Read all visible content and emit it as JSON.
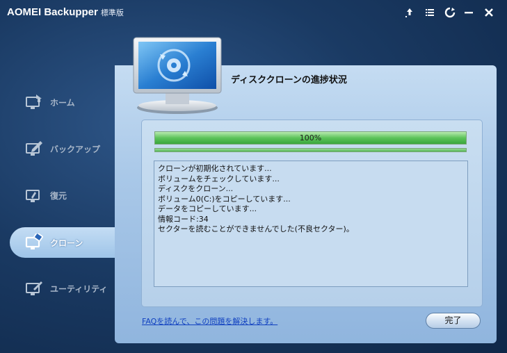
{
  "window": {
    "app_name": "AOMEI Backupper",
    "edition": "標準版",
    "icons": [
      "upgrade-icon",
      "menu-icon",
      "refresh-icon",
      "minimize-icon",
      "close-icon"
    ]
  },
  "sidebar": {
    "items": [
      {
        "label": "ホーム",
        "icon": "home-icon",
        "active": false
      },
      {
        "label": "バックアップ",
        "icon": "backup-icon",
        "active": false
      },
      {
        "label": "復元",
        "icon": "restore-icon",
        "active": false
      },
      {
        "label": "クローン",
        "icon": "clone-icon",
        "active": true
      },
      {
        "label": "ユーティリティ",
        "icon": "utility-icon",
        "active": false
      }
    ]
  },
  "main": {
    "title": "ディスククローンの進捗状況",
    "header_icon": "disk-clone-monitor-icon",
    "progress": {
      "value": 100,
      "label": "100%"
    },
    "log_lines": [
      "クローンが初期化されています...",
      "ボリュームをチェックしています...",
      "ディスクをクローン...",
      "ボリューム0(C:)をコピーしています...",
      "データをコピーしています...",
      "情報コード:34",
      "セクターを読むことができませんでした(不良セクター)。"
    ],
    "faq_link": "FAQを読んで、この問題を解決します。",
    "finish_label": "完了"
  },
  "colors": {
    "background": "#1a3a63",
    "panel": "#a9c8e8",
    "progress_green": "#5cc35a",
    "link": "#1040c0"
  }
}
